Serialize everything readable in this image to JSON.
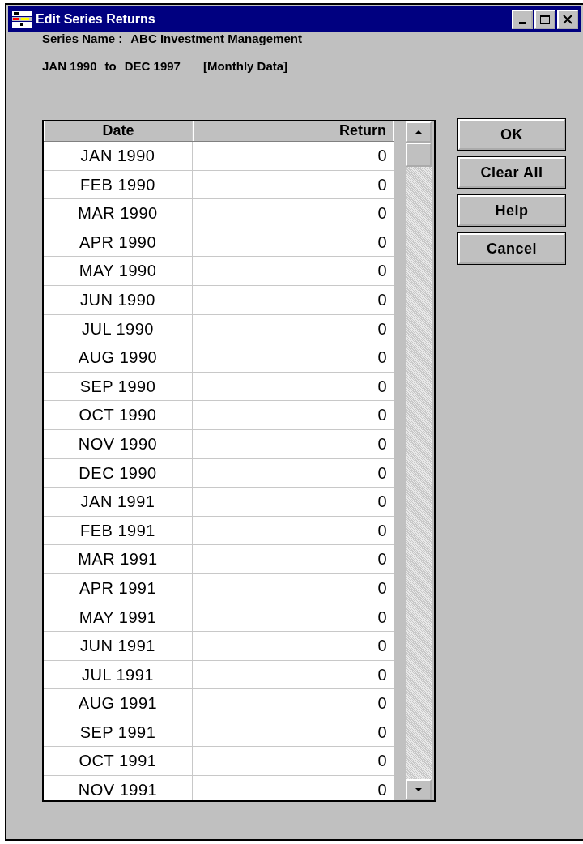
{
  "window": {
    "title": "Edit Series Returns"
  },
  "series_name": {
    "label": "Series Name :",
    "value": "ABC Investment Management"
  },
  "period": {
    "from": "JAN 1990",
    "to_word": "to",
    "to": "DEC 1997",
    "frequency": "[Monthly Data]"
  },
  "table": {
    "columns": [
      "Date",
      "Return"
    ],
    "rows": [
      {
        "date": "JAN 1990",
        "return": "0"
      },
      {
        "date": "FEB 1990",
        "return": "0"
      },
      {
        "date": "MAR 1990",
        "return": "0"
      },
      {
        "date": "APR 1990",
        "return": "0"
      },
      {
        "date": "MAY 1990",
        "return": "0"
      },
      {
        "date": "JUN 1990",
        "return": "0"
      },
      {
        "date": "JUL 1990",
        "return": "0"
      },
      {
        "date": "AUG 1990",
        "return": "0"
      },
      {
        "date": "SEP 1990",
        "return": "0"
      },
      {
        "date": "OCT 1990",
        "return": "0"
      },
      {
        "date": "NOV 1990",
        "return": "0"
      },
      {
        "date": "DEC 1990",
        "return": "0"
      },
      {
        "date": "JAN 1991",
        "return": "0"
      },
      {
        "date": "FEB 1991",
        "return": "0"
      },
      {
        "date": "MAR 1991",
        "return": "0"
      },
      {
        "date": "APR 1991",
        "return": "0"
      },
      {
        "date": "MAY 1991",
        "return": "0"
      },
      {
        "date": "JUN 1991",
        "return": "0"
      },
      {
        "date": "JUL 1991",
        "return": "0"
      },
      {
        "date": "AUG 1991",
        "return": "0"
      },
      {
        "date": "SEP 1991",
        "return": "0"
      },
      {
        "date": "OCT 1991",
        "return": "0"
      },
      {
        "date": "NOV 1991",
        "return": "0"
      }
    ]
  },
  "buttons": [
    "OK",
    "Clear All",
    "Help",
    "Cancel"
  ]
}
